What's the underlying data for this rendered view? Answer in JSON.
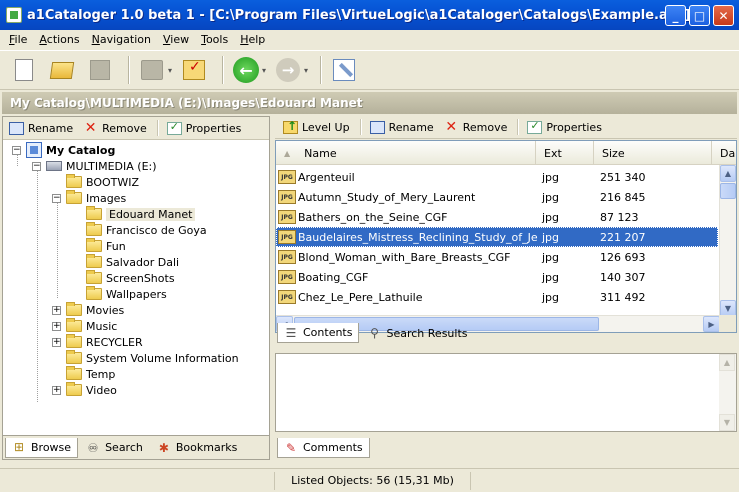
{
  "window": {
    "title": "a1Cataloger 1.0 beta 1 - [C:\\Program Files\\VirtueLogic\\a1Cataloger\\Catalogs\\Example.a1c]",
    "minimize": "_",
    "maximize": "□",
    "close": "✕"
  },
  "menu": [
    "File",
    "Actions",
    "Navigation",
    "View",
    "Tools",
    "Help"
  ],
  "toolbar": {
    "icons": [
      "new-catalog-icon",
      "open-catalog-icon",
      "save-icon",
      "group-icon",
      "check-icon",
      "back-icon",
      "forward-icon",
      "tools-icon"
    ],
    "back_glyph": "←",
    "forward_glyph": "→",
    "dropdown_glyph": "▾"
  },
  "address": "My Catalog\\MULTIMEDIA (E:)\\Images\\Edouard Manet",
  "left_panel": {
    "tools": {
      "rename": "Rename",
      "remove": "Remove",
      "properties": "Properties"
    },
    "tree": {
      "root": "My Catalog",
      "drive": "MULTIMEDIA (E:)",
      "nodes": [
        {
          "label": "BOOTWIZ",
          "expander": ""
        },
        {
          "label": "Images",
          "expander": "−"
        },
        {
          "label": "Edouard Manet",
          "expander": ""
        },
        {
          "label": "Francisco de Goya",
          "expander": ""
        },
        {
          "label": "Fun",
          "expander": ""
        },
        {
          "label": "Salvador Dali",
          "expander": ""
        },
        {
          "label": "ScreenShots",
          "expander": ""
        },
        {
          "label": "Wallpapers",
          "expander": ""
        },
        {
          "label": "Movies",
          "expander": "+"
        },
        {
          "label": "Music",
          "expander": "+"
        },
        {
          "label": "RECYCLER",
          "expander": "+"
        },
        {
          "label": "System Volume Information",
          "expander": ""
        },
        {
          "label": "Temp",
          "expander": ""
        },
        {
          "label": "Video",
          "expander": "+"
        }
      ],
      "root_expander": "−",
      "drive_expander": "−"
    },
    "tabs": {
      "browse": "Browse",
      "search": "Search",
      "bookmarks": "Bookmarks"
    }
  },
  "right_panel": {
    "tools": {
      "level_up": "Level Up",
      "rename": "Rename",
      "remove": "Remove",
      "properties": "Properties"
    },
    "columns": {
      "name": "Name",
      "ext": "Ext",
      "size": "Size",
      "date": "Da"
    },
    "files": [
      {
        "name": "Argenteuil",
        "ext": "jpg",
        "size": "251 340"
      },
      {
        "name": "Autumn_Study_of_Mery_Laurent",
        "ext": "jpg",
        "size": "216 845"
      },
      {
        "name": "Bathers_on_the_Seine_CGF",
        "ext": "jpg",
        "size": "87 123"
      },
      {
        "name": "Baudelaires_Mistress_Reclining_Study_of_Jea",
        "ext": "jpg",
        "size": "221 207"
      },
      {
        "name": "Blond_Woman_with_Bare_Breasts_CGF",
        "ext": "jpg",
        "size": "126 693"
      },
      {
        "name": "Boating_CGF",
        "ext": "jpg",
        "size": "140 307"
      },
      {
        "name": "Chez_Le_Pere_Lathuile",
        "ext": "jpg",
        "size": "311 492"
      }
    ],
    "selected_index": 3,
    "file_icon_label": "JPG",
    "tabs": {
      "contents": "Contents",
      "search_results": "Search Results",
      "comments": "Comments"
    }
  },
  "status": {
    "listed": "Listed Objects: 56 (15,31 Mb)"
  },
  "scroll": {
    "up": "▲",
    "down": "▼",
    "left": "◀",
    "right": "▶",
    "sort": "▲"
  }
}
